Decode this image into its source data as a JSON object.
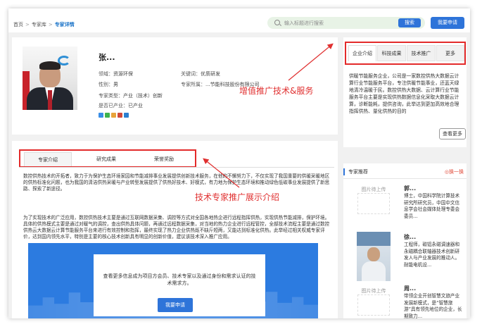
{
  "breadcrumb": {
    "home": "首页",
    "sep": ">",
    "library": "专家库",
    "current": "专家详情"
  },
  "search": {
    "placeholder": "输入标题进行搜索",
    "button": "搜索"
  },
  "apply_button": "我要申请",
  "profile": {
    "name": "张...",
    "field_label": "领域：",
    "field_value": "资源环保",
    "keyword_label": "关键词：",
    "keyword_value": "优质研发",
    "gender_label": "性别：",
    "gender_value": "男",
    "org_label": "专家所属：",
    "org_value": "...节能科技股份有限公司",
    "type_label": "专家类型：",
    "type_value": "产业（技术）创新",
    "industry_label": "是否已产业：",
    "industry_value": "已产业",
    "share_colors": [
      "#3a8ee6",
      "#3eb34f",
      "#e8a33a",
      "#d04a3a",
      "#2b7fd0"
    ]
  },
  "tabs": [
    {
      "label": "专家介绍",
      "active": true
    },
    {
      "label": "研究成果",
      "active": false
    },
    {
      "label": "荣誉奖励",
      "active": false
    }
  ],
  "intro_paragraphs": [
    "数控供热技术的开拓者，致力于为保护生态环境家园和节能减排事业发展提供创新技术服务，在他的不懈努力下，不仅实现了我国重要的供暖采暖地区的供热标准化问题，也为我国的清洁供热采暖与产业转型发展提供了供热好技术、好模式，有力地为保护生态环境和推动绿色低碳事业发展提供了新思路、探索了新途径。",
    "为了实现技术的广泛应用，数控供热技术主要是通过互联网数据采集、调控等方式对全国各地热企进行远程指挥供热，实现供热节能减排，保护环境。具体的供热模式主要是通过对暖气的调控，查出供热具体问题，再通过远程数据采集，对当地的热力企业进行远程管控，全部技术流程主要是通过数控供热云大数据云计算节能服务平台来进行有效控制和指挥，最终实现了热力企业供热既不缺斤短两，又能达到标准化供热。此举经过相关权威专家评价，达到国内领先水平，特别是主要的核心技术创新具有明显的创新价值，建议该技术深入推广应用。"
  ],
  "cta": {
    "text": "查看更多信息成为项目方会员、技术专家以及通过身份和需求认证的技术需求方。",
    "button": "我要申请"
  },
  "right_tabs": [
    {
      "label": "企业介绍",
      "active": true
    },
    {
      "label": "科技成果",
      "active": false
    },
    {
      "label": "技术推广",
      "active": false
    },
    {
      "label": "更多",
      "active": false
    }
  ],
  "company_desc": "供暖节能服务企业，公司是一家数控供热大数据云计算行业节能服务平台，专注供暖节能事业，还蓝天绿地清冷温暖于民。数控供热大数据、云计算行业节能服务平台主要是实现供热数据信息化采取大数据云计算，诊断能耗，提供咨询，此举达到更加高效地合理指挥供热、量化供热的目的",
  "more_button": "查看更多",
  "recommend": {
    "title": "专家推荐",
    "switch": "◎换一换",
    "img_placeholder": "图片待上传",
    "experts": [
      {
        "name": "郭...",
        "desc": "博士，中国科学院计算技术研究所研究员，中国中文信息学会社会媒体处理专委会委员..."
      },
      {
        "name": "徐...",
        "desc": "工程师，碳铝永磁调速器和永磁耦合联轴器技术创新研发人与产业发展的推动人。耐能电机设..."
      },
      {
        "name": "周...",
        "desc": "带领企业开创智慧文旅产业发展新模式，是“智慧旅游”具有领先地位的企业，长期致力..."
      }
    ]
  },
  "annotations": {
    "right": "增值推广技术&服务",
    "left": "技术专家推广展示介绍"
  }
}
